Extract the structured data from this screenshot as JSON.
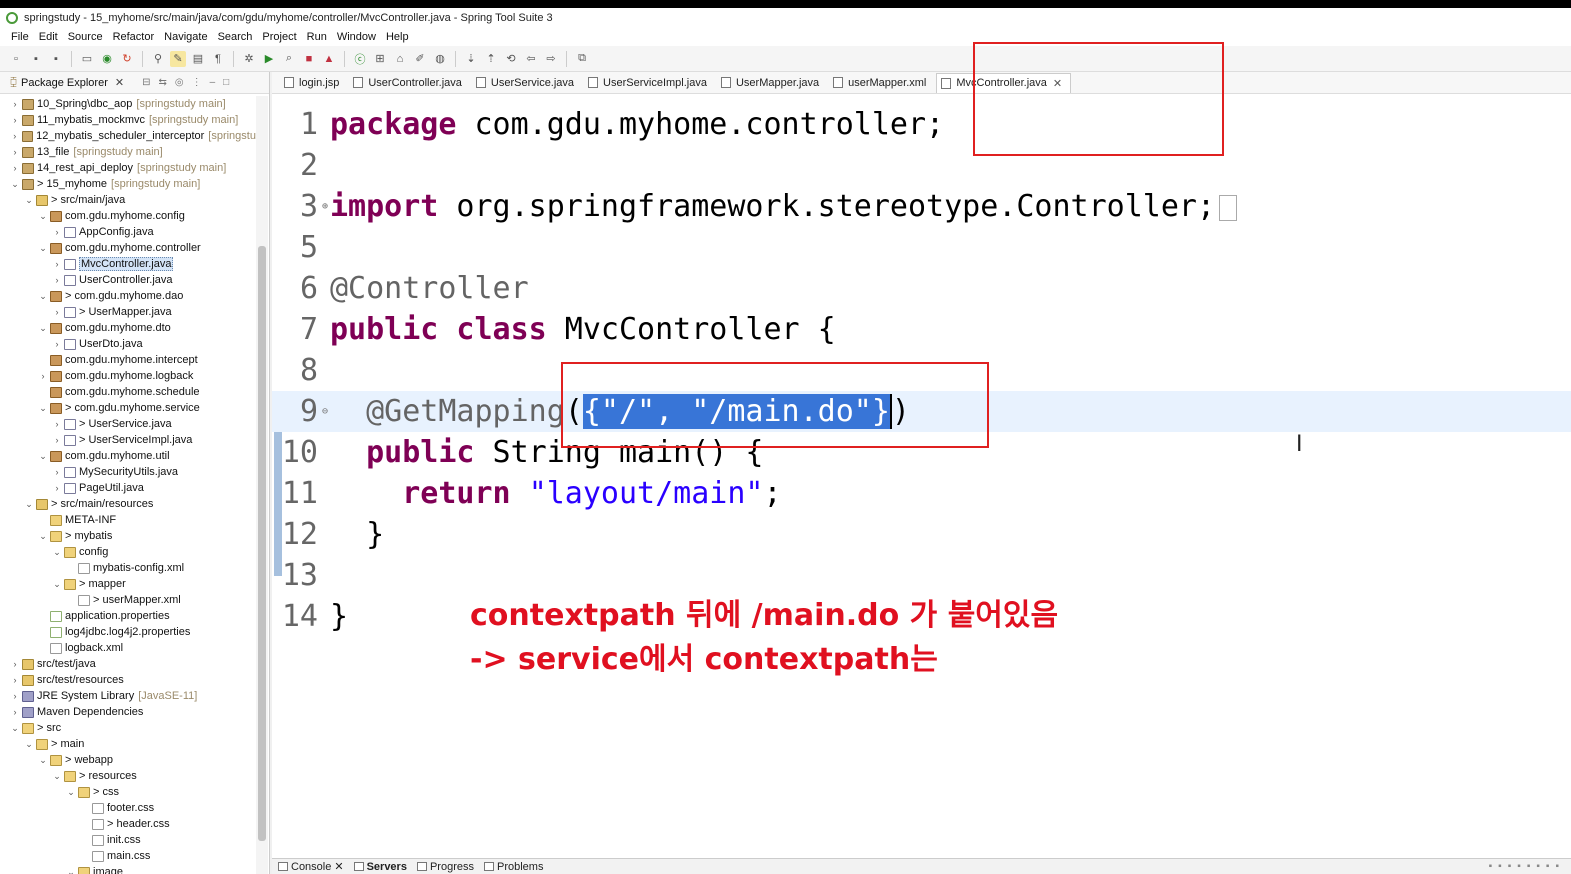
{
  "window": {
    "title": "springstudy - 15_myhome/src/main/java/com/gdu/myhome/controller/MvcController.java - Spring Tool Suite 3"
  },
  "menu": [
    "File",
    "Edit",
    "Source",
    "Refactor",
    "Navigate",
    "Search",
    "Project",
    "Run",
    "Window",
    "Help"
  ],
  "explorer": {
    "title": "Package Explorer",
    "close": "✕",
    "items": [
      {
        "label": "10_Spring\\dbc_aop",
        "dec": "[springstudy main]",
        "indent": 0,
        "twisty": "›",
        "icon": "project"
      },
      {
        "label": "11_mybatis_mockmvc",
        "dec": "[springstudy main]",
        "indent": 0,
        "twisty": "›",
        "icon": "project"
      },
      {
        "label": "12_mybatis_scheduler_interceptor",
        "dec": "[springstu",
        "indent": 0,
        "twisty": "›",
        "icon": "project"
      },
      {
        "label": "13_file",
        "dec": "[springstudy main]",
        "indent": 0,
        "twisty": "›",
        "icon": "project"
      },
      {
        "label": "14_rest_api_deploy",
        "dec": "[springstudy main]",
        "indent": 0,
        "twisty": "›",
        "icon": "project"
      },
      {
        "label": "> 15_myhome",
        "dec": "[springstudy main]",
        "indent": 0,
        "twisty": "⌄",
        "icon": "project"
      },
      {
        "label": "> src/main/java",
        "dec": "",
        "indent": 1,
        "twisty": "⌄",
        "icon": "srcfolder"
      },
      {
        "label": "com.gdu.myhome.config",
        "dec": "",
        "indent": 2,
        "twisty": "⌄",
        "icon": "package"
      },
      {
        "label": "AppConfig.java",
        "dec": "",
        "indent": 3,
        "twisty": "›",
        "icon": "java"
      },
      {
        "label": "com.gdu.myhome.controller",
        "dec": "",
        "indent": 2,
        "twisty": "⌄",
        "icon": "package"
      },
      {
        "label": "MvcController.java",
        "dec": "",
        "indent": 3,
        "twisty": "›",
        "icon": "java",
        "selected": true
      },
      {
        "label": "UserController.java",
        "dec": "",
        "indent": 3,
        "twisty": "›",
        "icon": "java"
      },
      {
        "label": "> com.gdu.myhome.dao",
        "dec": "",
        "indent": 2,
        "twisty": "⌄",
        "icon": "package"
      },
      {
        "label": "> UserMapper.java",
        "dec": "",
        "indent": 3,
        "twisty": "›",
        "icon": "java"
      },
      {
        "label": "com.gdu.myhome.dto",
        "dec": "",
        "indent": 2,
        "twisty": "⌄",
        "icon": "package"
      },
      {
        "label": "UserDto.java",
        "dec": "",
        "indent": 3,
        "twisty": "›",
        "icon": "java"
      },
      {
        "label": "com.gdu.myhome.intercept",
        "dec": "",
        "indent": 2,
        "twisty": "",
        "icon": "package"
      },
      {
        "label": "com.gdu.myhome.logback",
        "dec": "",
        "indent": 2,
        "twisty": "›",
        "icon": "package"
      },
      {
        "label": "com.gdu.myhome.schedule",
        "dec": "",
        "indent": 2,
        "twisty": "",
        "icon": "package"
      },
      {
        "label": "> com.gdu.myhome.service",
        "dec": "",
        "indent": 2,
        "twisty": "⌄",
        "icon": "package"
      },
      {
        "label": "> UserService.java",
        "dec": "",
        "indent": 3,
        "twisty": "›",
        "icon": "java"
      },
      {
        "label": "> UserServiceImpl.java",
        "dec": "",
        "indent": 3,
        "twisty": "›",
        "icon": "java"
      },
      {
        "label": "com.gdu.myhome.util",
        "dec": "",
        "indent": 2,
        "twisty": "⌄",
        "icon": "package"
      },
      {
        "label": "MySecurityUtils.java",
        "dec": "",
        "indent": 3,
        "twisty": "›",
        "icon": "java"
      },
      {
        "label": "PageUtil.java",
        "dec": "",
        "indent": 3,
        "twisty": "›",
        "icon": "java"
      },
      {
        "label": "> src/main/resources",
        "dec": "",
        "indent": 1,
        "twisty": "⌄",
        "icon": "srcfolder"
      },
      {
        "label": "META-INF",
        "dec": "",
        "indent": 2,
        "twisty": "",
        "icon": "folder"
      },
      {
        "label": "> mybatis",
        "dec": "",
        "indent": 2,
        "twisty": "⌄",
        "icon": "folder"
      },
      {
        "label": "config",
        "dec": "",
        "indent": 3,
        "twisty": "⌄",
        "icon": "folder"
      },
      {
        "label": "mybatis-config.xml",
        "dec": "",
        "indent": 4,
        "twisty": "",
        "icon": "xml"
      },
      {
        "label": "> mapper",
        "dec": "",
        "indent": 3,
        "twisty": "⌄",
        "icon": "folder"
      },
      {
        "label": "> userMapper.xml",
        "dec": "",
        "indent": 4,
        "twisty": "",
        "icon": "xml"
      },
      {
        "label": "application.properties",
        "dec": "",
        "indent": 2,
        "twisty": "",
        "icon": "props"
      },
      {
        "label": "log4jdbc.log4j2.properties",
        "dec": "",
        "indent": 2,
        "twisty": "",
        "icon": "props"
      },
      {
        "label": "logback.xml",
        "dec": "",
        "indent": 2,
        "twisty": "",
        "icon": "xml"
      },
      {
        "label": "src/test/java",
        "dec": "",
        "indent": 0,
        "twisty": "›",
        "icon": "srcfolder"
      },
      {
        "label": "src/test/resources",
        "dec": "",
        "indent": 0,
        "twisty": "›",
        "icon": "srcfolder"
      },
      {
        "label": "JRE System Library",
        "dec": "[JavaSE-11]",
        "indent": 0,
        "twisty": "›",
        "icon": "lib"
      },
      {
        "label": "Maven Dependencies",
        "dec": "",
        "indent": 0,
        "twisty": "›",
        "icon": "lib"
      },
      {
        "label": "> src",
        "dec": "",
        "indent": 0,
        "twisty": "⌄",
        "icon": "folder"
      },
      {
        "label": "> main",
        "dec": "",
        "indent": 1,
        "twisty": "⌄",
        "icon": "folder"
      },
      {
        "label": "> webapp",
        "dec": "",
        "indent": 2,
        "twisty": "⌄",
        "icon": "folder"
      },
      {
        "label": "> resources",
        "dec": "",
        "indent": 3,
        "twisty": "⌄",
        "icon": "folder"
      },
      {
        "label": "> css",
        "dec": "",
        "indent": 4,
        "twisty": "⌄",
        "icon": "folder"
      },
      {
        "label": "footer.css",
        "dec": "",
        "indent": 5,
        "twisty": "",
        "icon": "xml"
      },
      {
        "label": "> header.css",
        "dec": "",
        "indent": 5,
        "twisty": "",
        "icon": "xml"
      },
      {
        "label": "init.css",
        "dec": "",
        "indent": 5,
        "twisty": "",
        "icon": "xml"
      },
      {
        "label": "main.css",
        "dec": "",
        "indent": 5,
        "twisty": "",
        "icon": "xml"
      },
      {
        "label": "image",
        "dec": "",
        "indent": 4,
        "twisty": "⌄",
        "icon": "folder"
      }
    ]
  },
  "editor": {
    "tabs": [
      {
        "label": "login.jsp",
        "active": false
      },
      {
        "label": "UserController.java",
        "active": false
      },
      {
        "label": "UserService.java",
        "active": false
      },
      {
        "label": "UserServiceImpl.java",
        "active": false
      },
      {
        "label": "UserMapper.java",
        "active": false
      },
      {
        "label": "userMapper.xml",
        "active": false
      },
      {
        "label": "MvcController.java",
        "active": true
      }
    ],
    "tab_close": "✕",
    "line_numbers": {
      "l1": "1",
      "l2": "2",
      "l3": "3",
      "l5": "5",
      "l6": "6",
      "l7": "7",
      "l8": "8",
      "l9": "9",
      "l10": "10",
      "l11": "11",
      "l12": "12",
      "l13": "13",
      "l14": "14"
    },
    "code": {
      "l1_kw": "package",
      "l1_rest": " com.gdu.myhome.controller;",
      "l3_kw": "import",
      "l3_rest": " org.springframework.stereotype.Controller;",
      "l6_ann": "@Controller",
      "l7_kw1": "public",
      "l7_kw2": " class",
      "l7_rest": " MvcController {",
      "l9_ann": "  @GetMapping",
      "l9_paren": "(",
      "l9_sel": "{\"/\", \"/main.do\"}",
      "l9_close": ")",
      "l10_indent": "  ",
      "l10_kw": "public",
      "l10_rest": " String main() {",
      "l11_indent": "    ",
      "l11_kw": "return",
      "l11_sp": " ",
      "l11_str": "\"layout/main\"",
      "l11_end": ";",
      "l12": "  }",
      "l14": "}"
    }
  },
  "annotation_note": {
    "line1": "contextpath 뒤에 /main.do 가 붙어있음",
    "line2": "-> service에서 contextpath는"
  },
  "bottom_tabs": [
    {
      "label": "Console",
      "close": "✕",
      "active": false
    },
    {
      "label": "Servers",
      "close": "",
      "active": true
    },
    {
      "label": "Progress",
      "close": "",
      "active": false
    },
    {
      "label": "Problems",
      "close": "",
      "active": false
    }
  ]
}
